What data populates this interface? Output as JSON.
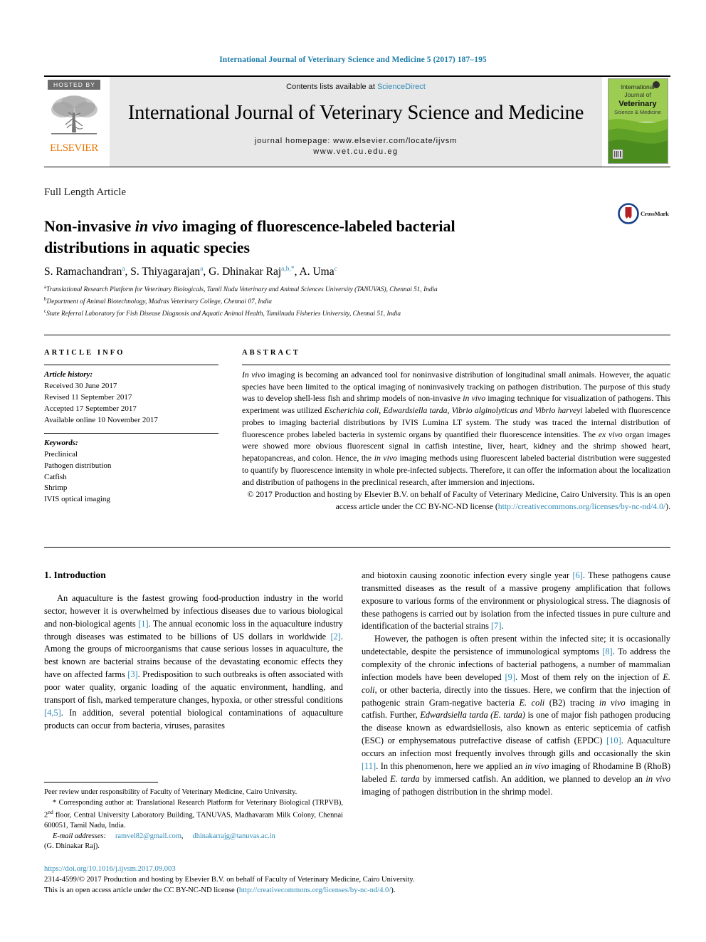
{
  "running_head": "International Journal of Veterinary Science and Medicine 5 (2017) 187–195",
  "masthead": {
    "hosted_by": "HOSTED BY",
    "publisher": "ELSEVIER",
    "contents_prefix": "Contents lists available at ",
    "contents_link": "ScienceDirect",
    "journal_title": "International Journal of Veterinary Science and Medicine",
    "homepage_line1": "journal homepage: www.elsevier.com/locate/ijvsm",
    "homepage_line2": "www.vet.cu.edu.eg",
    "cover": {
      "line1": "International",
      "line2": "Journal of",
      "line3": "Veterinary",
      "line4": "Science & Medicine"
    }
  },
  "article": {
    "type": "Full Length Article",
    "title_part1": "Non-invasive ",
    "title_italic": "in vivo",
    "title_part2": " imaging of fluorescence-labeled bacterial distributions in aquatic species",
    "crossmark_label": "CrossMark",
    "authors": [
      {
        "name": "S. Ramachandran",
        "sup": "a"
      },
      {
        "name": "S. Thiyagarajan",
        "sup": "a"
      },
      {
        "name": "G. Dhinakar Raj",
        "sup": "a,b,*"
      },
      {
        "name": "A. Uma",
        "sup": "c"
      }
    ],
    "affiliations": [
      {
        "sup": "a",
        "text": "Translational Research Platform for Veterinary Biologicals, Tamil Nadu Veterinary and Animal Sciences University (TANUVAS), Chennai 51, India"
      },
      {
        "sup": "b",
        "text": "Department of Animal Biotechnology, Madras Veterinary College, Chennai 07, India"
      },
      {
        "sup": "c",
        "text": "State Referral Laboratory for Fish Disease Diagnosis and Aquatic Animal Health, Tamilnadu Fisheries University, Chennai 51, India"
      }
    ]
  },
  "article_info": {
    "heading": "ARTICLE INFO",
    "history_label": "Article history:",
    "history": [
      "Received 30 June 2017",
      "Revised 11 September 2017",
      "Accepted 17 September 2017",
      "Available online 10 November 2017"
    ],
    "keywords_label": "Keywords:",
    "keywords": [
      "Preclinical",
      "Pathogen distribution",
      "Catfish",
      "Shrimp",
      "IVIS optical imaging"
    ]
  },
  "abstract": {
    "heading": "ABSTRACT",
    "copyright": "© 2017 Production and hosting by Elsevier B.V. on behalf of Faculty of Veterinary Medicine, Cairo University. This is an open access article under the CC BY-NC-ND license (",
    "copyright_link": "http://creativecommons.org/licenses/by-nc-nd/4.0/",
    "copyright_tail": ")."
  },
  "introduction": {
    "heading": "1. Introduction"
  },
  "footnotes": {
    "peer_review": "Peer review under responsibility of Faculty of Veterinary Medicine, Cairo University.",
    "corresponding_prefix": "* Corresponding author at: Translational Research Platform for Veterinary Biological (TRPVB), 2",
    "corresponding_sup": "nd",
    "corresponding_rest": " floor, Central University Laboratory Building, TANUVAS, Madhavaram Milk Colony, Chennai 600051, Tamil Nadu, India.",
    "email_label": "E-mail addresses:",
    "email1": "ramvel82@gmail.com",
    "email2": "dhinakarrajg@tanuvas.ac.in",
    "email_owner": "(G. Dhinakar Raj)."
  },
  "bottom": {
    "doi": "https://doi.org/10.1016/j.ijvsm.2017.09.003",
    "issn_line": "2314-4599/© 2017 Production and hosting by Elsevier B.V. on behalf of Faculty of Veterinary Medicine, Cairo University.",
    "license_prefix": "This is an open access article under the CC BY-NC-ND license (",
    "license_link": "http://creativecommons.org/licenses/by-nc-nd/4.0/",
    "license_tail": ")."
  }
}
